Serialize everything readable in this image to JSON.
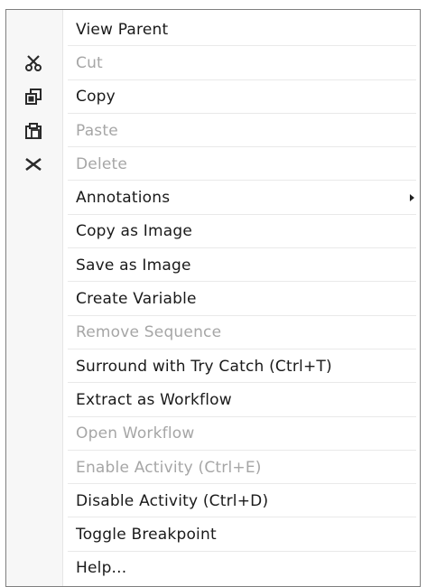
{
  "context_menu": {
    "items": [
      {
        "label": "View Parent",
        "enabled": true
      },
      {
        "label": "Cut",
        "enabled": false,
        "icon": "scissors-icon"
      },
      {
        "label": "Copy",
        "enabled": true,
        "icon": "copy-icon"
      },
      {
        "label": "Paste",
        "enabled": false,
        "icon": "paste-icon"
      },
      {
        "label": "Delete",
        "enabled": false,
        "icon": "delete-x-icon"
      },
      {
        "label": "Annotations",
        "enabled": true,
        "has_submenu": true
      },
      {
        "label": "Copy as Image",
        "enabled": true
      },
      {
        "label": "Save as Image",
        "enabled": true
      },
      {
        "label": "Create Variable",
        "enabled": true
      },
      {
        "label": "Remove Sequence",
        "enabled": false
      },
      {
        "label": "Surround with Try Catch (Ctrl+T)",
        "enabled": true
      },
      {
        "label": "Extract as Workflow",
        "enabled": true
      },
      {
        "label": "Open Workflow",
        "enabled": false
      },
      {
        "label": "Enable Activity (Ctrl+E)",
        "enabled": false
      },
      {
        "label": "Disable Activity (Ctrl+D)",
        "enabled": true
      },
      {
        "label": "Toggle Breakpoint",
        "enabled": true
      },
      {
        "label": "Help...",
        "enabled": true
      }
    ],
    "colors": {
      "text": "#1a1a1a",
      "disabled_text": "#a6a6a6",
      "border": "#7f7f7f"
    }
  }
}
